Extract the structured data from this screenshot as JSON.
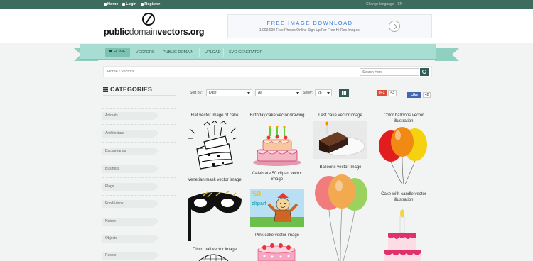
{
  "topbar": {
    "home": "Home",
    "login": "Login",
    "register": "Register",
    "change_language": "Change language",
    "lang": "EN"
  },
  "logo": {
    "public": "public",
    "domain": "domain",
    "vectors": "vectors.org"
  },
  "ad": {
    "title": "FREE IMAGE DOWNLOAD",
    "subtitle": "1,000,000 Free Photos Online Sign Up For Free Hi-Res Images!"
  },
  "nav": [
    "HOME",
    "VECTORS",
    "PUBLIC DOMAIN",
    "UPLOAD",
    "SVG GENERATOR"
  ],
  "breadcrumb": "Home / Vectors",
  "search": {
    "placeholder": "Search Here"
  },
  "sidebar": {
    "heading": "CATEGORIES",
    "items": [
      "Animals",
      "Architecture",
      "Backgrounds",
      "Business",
      "Flags",
      "Food&drink",
      "Nature",
      "Objects",
      "People"
    ]
  },
  "filter": {
    "sort_label": "Sort By:",
    "sort_value": "Date",
    "type_value": "All",
    "show_label": "Show:",
    "show_value": "28"
  },
  "social": {
    "gplus": "g+1",
    "gplus_count": "43",
    "fb_like": "Like",
    "fb_count": "42"
  },
  "tiles": [
    {
      "title": "Flat vector image of cake"
    },
    {
      "title": "Birthday cake vector drawing"
    },
    {
      "title": "Last cake vector image"
    },
    {
      "title": "Color balloons vector illustration"
    },
    {
      "title": "Venetian mask vector image"
    },
    {
      "title": "Celebrate 50 clipart vector image",
      "badge": "50",
      "word": "clipart"
    },
    {
      "title": "Balloons vector image"
    },
    {
      "title": "Cake with candle vector illustration"
    },
    {
      "title": "Disco ball vector image"
    },
    {
      "title": "Pink cake vector image"
    }
  ],
  "colors": {
    "topbar": "#3d6b5e",
    "nav": "#a7ddd2",
    "accent": "#345c54"
  }
}
